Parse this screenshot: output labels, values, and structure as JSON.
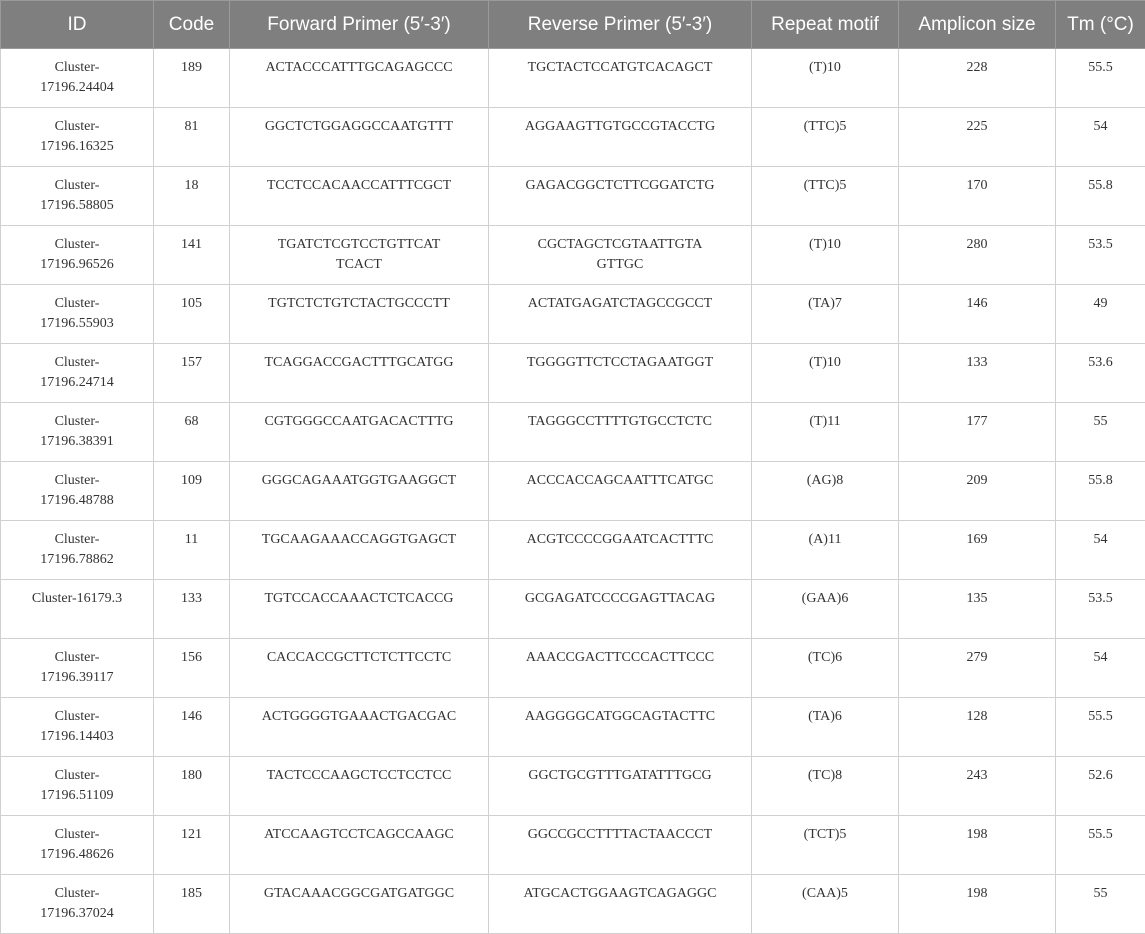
{
  "table": {
    "headers": [
      "ID",
      "Code",
      "Forward Primer (5′-3′)",
      "Reverse Primer (5′-3′)",
      "Repeat motif",
      "Amplicon size",
      "Tm (°C)"
    ],
    "rows": [
      {
        "id": "Cluster-\n17196.24404",
        "code": "189",
        "forward": "ACTACCCATTTGCAGAGCCC",
        "reverse": "TGCTACTCCATGTCACAGCT",
        "motif": "(T)10",
        "amplicon": "228",
        "tm": "55.5"
      },
      {
        "id": "Cluster-\n17196.16325",
        "code": "81",
        "forward": "GGCTCTGGAGGCCAATGTTT",
        "reverse": "AGGAAGTTGTGCCGTACCTG",
        "motif": "(TTC)5",
        "amplicon": "225",
        "tm": "54"
      },
      {
        "id": "Cluster-\n17196.58805",
        "code": "18",
        "forward": "TCCTCCACAACCATTTCGCT",
        "reverse": "GAGACGGCTCTTCGGATCTG",
        "motif": "(TTC)5",
        "amplicon": "170",
        "tm": "55.8"
      },
      {
        "id": "Cluster-\n17196.96526",
        "code": "141",
        "forward": "TGATCTCGTCCTGTTCAT\nTCACT",
        "reverse": "CGCTAGCTCGTAATTGTA\nGTTGC",
        "motif": "(T)10",
        "amplicon": "280",
        "tm": "53.5"
      },
      {
        "id": "Cluster-\n17196.55903",
        "code": "105",
        "forward": "TGTCTCTGTCTACTGCCCTT",
        "reverse": "ACTATGAGATCTAGCCGCCT",
        "motif": "(TA)7",
        "amplicon": "146",
        "tm": "49"
      },
      {
        "id": "Cluster-\n17196.24714",
        "code": "157",
        "forward": "TCAGGACCGACTTTGCATGG",
        "reverse": "TGGGGTTCTCCTAGAATGGT",
        "motif": "(T)10",
        "amplicon": "133",
        "tm": "53.6"
      },
      {
        "id": "Cluster-\n17196.38391",
        "code": "68",
        "forward": "CGTGGGCCAATGACACTTTG",
        "reverse": "TAGGGCCTTTTGTGCCTCTC",
        "motif": "(T)11",
        "amplicon": "177",
        "tm": "55"
      },
      {
        "id": "Cluster-\n17196.48788",
        "code": "109",
        "forward": "GGGCAGAAATGGTGAAGGCT",
        "reverse": "ACCCACCAGCAATTTCATGC",
        "motif": "(AG)8",
        "amplicon": "209",
        "tm": "55.8"
      },
      {
        "id": "Cluster-\n17196.78862",
        "code": "11",
        "forward": "TGCAAGAAACCAGGTGAGCT",
        "reverse": "ACGTCCCCGGAATCACTTTC",
        "motif": "(A)11",
        "amplicon": "169",
        "tm": "54"
      },
      {
        "id": "Cluster-16179.3",
        "code": "133",
        "forward": "TGTCCACCAAACTCTCACCG",
        "reverse": "GCGAGATCCCCGAGTTACAG",
        "motif": "(GAA)6",
        "amplicon": "135",
        "tm": "53.5"
      },
      {
        "id": "Cluster-\n17196.39117",
        "code": "156",
        "forward": "CACCACCGCTTCTCTTCCTC",
        "reverse": "AAACCGACTTCCCACTTCCC",
        "motif": "(TC)6",
        "amplicon": "279",
        "tm": "54"
      },
      {
        "id": "Cluster-\n17196.14403",
        "code": "146",
        "forward": "ACTGGGGTGAAACTGACGAC",
        "reverse": "AAGGGGCATGGCAGTACTTC",
        "motif": "(TA)6",
        "amplicon": "128",
        "tm": "55.5"
      },
      {
        "id": "Cluster-\n17196.51109",
        "code": "180",
        "forward": "TACTCCCAAGCTCCTCCTCC",
        "reverse": "GGCTGCGTTTGATATTTGCG",
        "motif": "(TC)8",
        "amplicon": "243",
        "tm": "52.6"
      },
      {
        "id": "Cluster-\n17196.48626",
        "code": "121",
        "forward": "ATCCAAGTCCTCAGCCAAGC",
        "reverse": "GGCCGCCTTTTACTAACCCT",
        "motif": "(TCT)5",
        "amplicon": "198",
        "tm": "55.5"
      },
      {
        "id": "Cluster-\n17196.37024",
        "code": "185",
        "forward": "GTACAAACGGCGATGATGGC",
        "reverse": "ATGCACTGGAAGTCAGAGGC",
        "motif": "(CAA)5",
        "amplicon": "198",
        "tm": "55"
      }
    ]
  },
  "colors": {
    "header_background": "#7f7f7f",
    "header_text": "#ffffff",
    "cell_text": "#333333",
    "border": "#d0d0d0"
  }
}
